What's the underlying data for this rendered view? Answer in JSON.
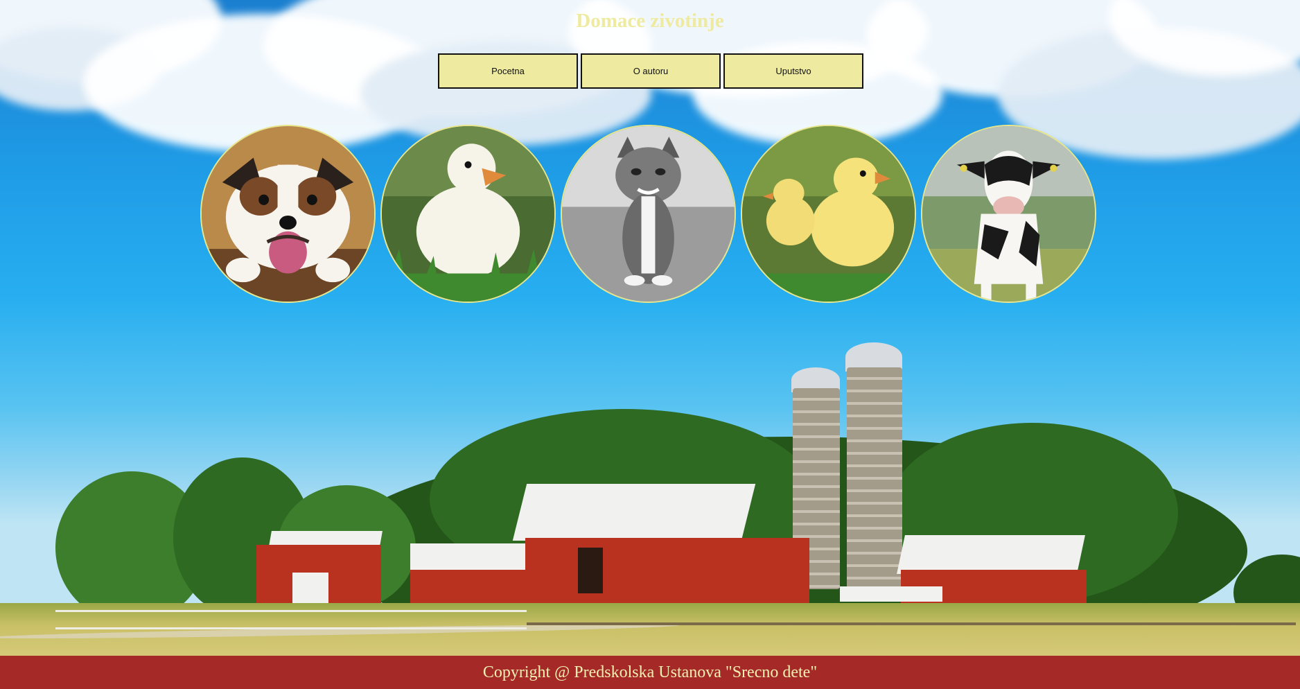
{
  "header": {
    "title": "Domace zivotinje"
  },
  "nav": {
    "items": [
      {
        "label": "Pocetna"
      },
      {
        "label": "O autoru"
      },
      {
        "label": "Uputstvo"
      }
    ]
  },
  "gallery": {
    "animals": [
      "dog-photo",
      "duckling-photo",
      "kitten-photo",
      "chicks-photo",
      "cow-photo"
    ]
  },
  "colors": {
    "accent": "#eeeaa0",
    "footer_bg": "#a52a27",
    "footer_text": "#f2efb2"
  },
  "footer": {
    "copyright": "Copyright @ Predskolska Ustanova \"Srecno dete\""
  }
}
